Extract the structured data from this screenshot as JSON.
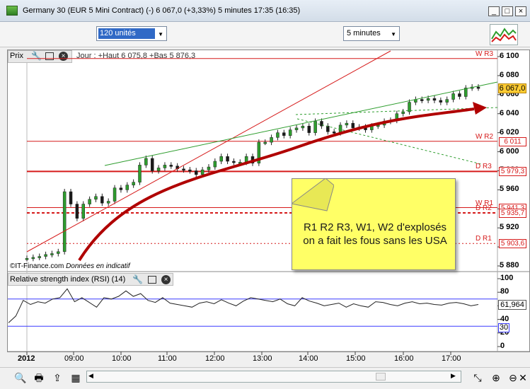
{
  "window": {
    "title": "Germany 30 (EUR 5 Mini Contract) (-)   6 067,0 (+3,33%)   5 minutes  17:35 (16:35)",
    "minimize": "_",
    "maximize": "□",
    "close": "×"
  },
  "toolbar": {
    "units_value": "120 unités",
    "interval_value": "5 minutes"
  },
  "price_panel": {
    "label": "Prix",
    "info": "Jour : +Haut 6 075,8 +Bas 5 876,3",
    "credit": "©IT-Finance.com",
    "credit_note": "Données en indicatif",
    "y_ticks": [
      "6 100",
      "6 080",
      "6 060",
      "6 040",
      "6 020",
      "6 000",
      "5 980",
      "5 960",
      "5 940",
      "5 920",
      "5 900",
      "5 880"
    ],
    "last_price": "6 067,0",
    "levels": [
      {
        "name": "W R3",
        "value": ""
      },
      {
        "name": "W R2",
        "value": "6 011"
      },
      {
        "name": "D R3",
        "value": "5 979,3"
      },
      {
        "name": "W R1",
        "value": "5 941,3"
      },
      {
        "name": "D R2",
        "value": "5 935,7"
      },
      {
        "name": "D R1",
        "value": "5 903,6"
      }
    ]
  },
  "rsi_panel": {
    "label": "Relative strength index (RSI) (14)",
    "y_ticks": [
      "100",
      "80",
      "60",
      "40",
      "20",
      "0"
    ],
    "last_value": "61,964",
    "low_level": "30"
  },
  "x_axis": [
    "2012",
    "09:00",
    "10:00",
    "11:00",
    "12:00",
    "13:00",
    "14:00",
    "15:00",
    "16:00",
    "17:00"
  ],
  "note": {
    "text": "R1 R2 R3, W1, W2 d'explosés on a fait les fous sans les USA"
  },
  "colors": {
    "up_candle": "#2e9d2e",
    "down_candle": "#1a1a1a",
    "resistance": "#d61a1a",
    "trendline": "#2e9d2e",
    "arrow": "#b00000",
    "rsi_line": "#222222",
    "rsi_level": "#3a3aff",
    "price_tag": "#ffcc33"
  },
  "icons": {
    "price_tools": [
      "wrench-icon",
      "window-icon",
      "close-icon"
    ],
    "bottom_left": [
      "zoom-in-icon",
      "print-icon",
      "export-icon",
      "grid-icon",
      "scroll-left-icon"
    ],
    "bottom_right": [
      "scroll-right-icon",
      "fit-icon",
      "zoom-in-icon",
      "zoom-out-icon",
      "cross-icon"
    ]
  }
}
